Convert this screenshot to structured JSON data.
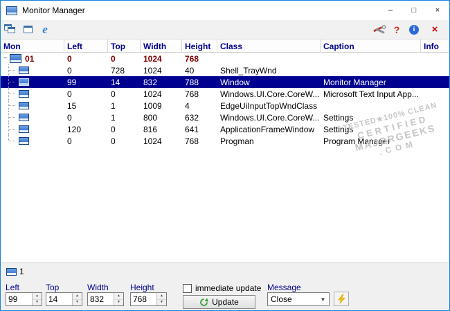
{
  "titlebar": {
    "title": "Monitor Manager",
    "minimize": "–",
    "maximize": "□",
    "close": "×"
  },
  "toolbar": {
    "help": "?",
    "info": "i",
    "close": "×"
  },
  "table": {
    "columns": [
      "Mon",
      "Left",
      "Top",
      "Width",
      "Height",
      "Class",
      "Caption",
      "Info"
    ],
    "root": {
      "toggle": "−",
      "mon": "01",
      "left": "0",
      "top": "0",
      "width": "1024",
      "height": "768"
    },
    "rows": [
      {
        "left": "0",
        "top": "728",
        "width": "1024",
        "height": "40",
        "class": "Shell_TrayWnd",
        "caption": ""
      },
      {
        "left": "99",
        "top": "14",
        "width": "832",
        "height": "788",
        "class": "Window",
        "caption": "Monitor Manager"
      },
      {
        "left": "0",
        "top": "0",
        "width": "1024",
        "height": "768",
        "class": "Windows.UI.Core.CoreW...",
        "caption": "Microsoft Text Input App..."
      },
      {
        "left": "15",
        "top": "1",
        "width": "1009",
        "height": "4",
        "class": "EdgeUiInputTopWndClass",
        "caption": ""
      },
      {
        "left": "0",
        "top": "1",
        "width": "800",
        "height": "632",
        "class": "Windows.UI.Core.CoreW...",
        "caption": "Settings"
      },
      {
        "left": "120",
        "top": "0",
        "width": "816",
        "height": "641",
        "class": "ApplicationFrameWindow",
        "caption": "Settings"
      },
      {
        "left": "0",
        "top": "0",
        "width": "1024",
        "height": "768",
        "class": "Progman",
        "caption": "Program Manager"
      }
    ]
  },
  "watermark": {
    "line1": "TESTED★100% CLEAN",
    "line2": "CERTIFIED",
    "line3": "MAJORGEEKS",
    "line4": ".COM"
  },
  "bottom": {
    "monitor_number": "1",
    "left_label": "Left",
    "left_value": "99",
    "top_label": "Top",
    "top_value": "14",
    "width_label": "Width",
    "width_value": "832",
    "height_label": "Height",
    "height_value": "768",
    "immediate_update_label": "immediate update",
    "update_label": "Update",
    "message_label": "Message",
    "message_value": "Close"
  }
}
